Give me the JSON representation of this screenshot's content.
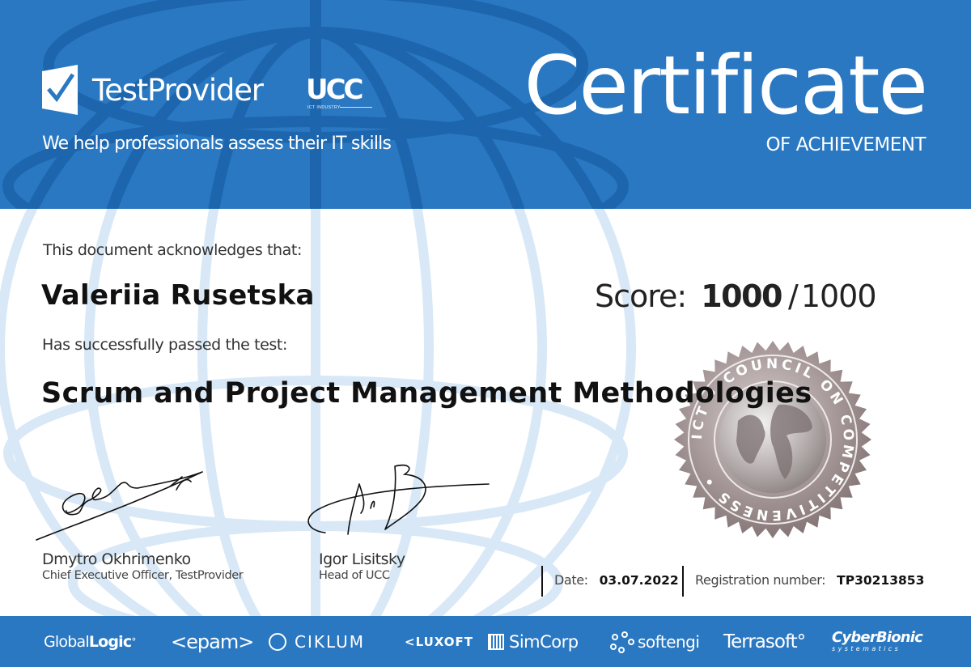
{
  "header": {
    "brand_name": "TestProvider",
    "partner_logo_text": "UCC",
    "partner_logo_subtext": "ICT INDUSTRY",
    "tagline": "We help professionals assess their IT skills",
    "title": "Certificate",
    "subtitle": "OF ACHIEVEMENT"
  },
  "body": {
    "ack_text": "This document acknowledges that:",
    "recipient_name": "Valeriia Rusetska",
    "passed_text": "Has successfully passed the test:",
    "test_name": "Scrum and Project Management Methodologies"
  },
  "score": {
    "label": "Score:",
    "value": "1000",
    "separator": "/",
    "max": "1000"
  },
  "seal": {
    "text": "ICT • COUNCIL ON COMPETITIVENESS •"
  },
  "signatories": [
    {
      "name": "Dmytro Okhrimenko",
      "role": "Chief Executive Officer, TestProvider"
    },
    {
      "name": "Igor Lisitsky",
      "role": "Head of UCC"
    }
  ],
  "details": {
    "date_label": "Date:",
    "date_value": "03.07.2022",
    "registration_label": "Registration number:",
    "registration_value": "TP30213853"
  },
  "partners": {
    "globallogic_a": "Global",
    "globallogic_b": "Logic",
    "globallogic_c": "°",
    "epam": "<epam>",
    "ciklum": "CIKLUM",
    "luxoft": "<LUXOFT",
    "simcorp": "SimCorp",
    "softengi": "softengi",
    "terrasoft": "Terrasoft°",
    "cyberbionic": "CyberBionic",
    "cyberbionic_sub": "systematics"
  },
  "colors": {
    "brand_blue": "#2a78c2",
    "globe_line_light": "#cfe2f3",
    "text_dark": "#111111"
  }
}
